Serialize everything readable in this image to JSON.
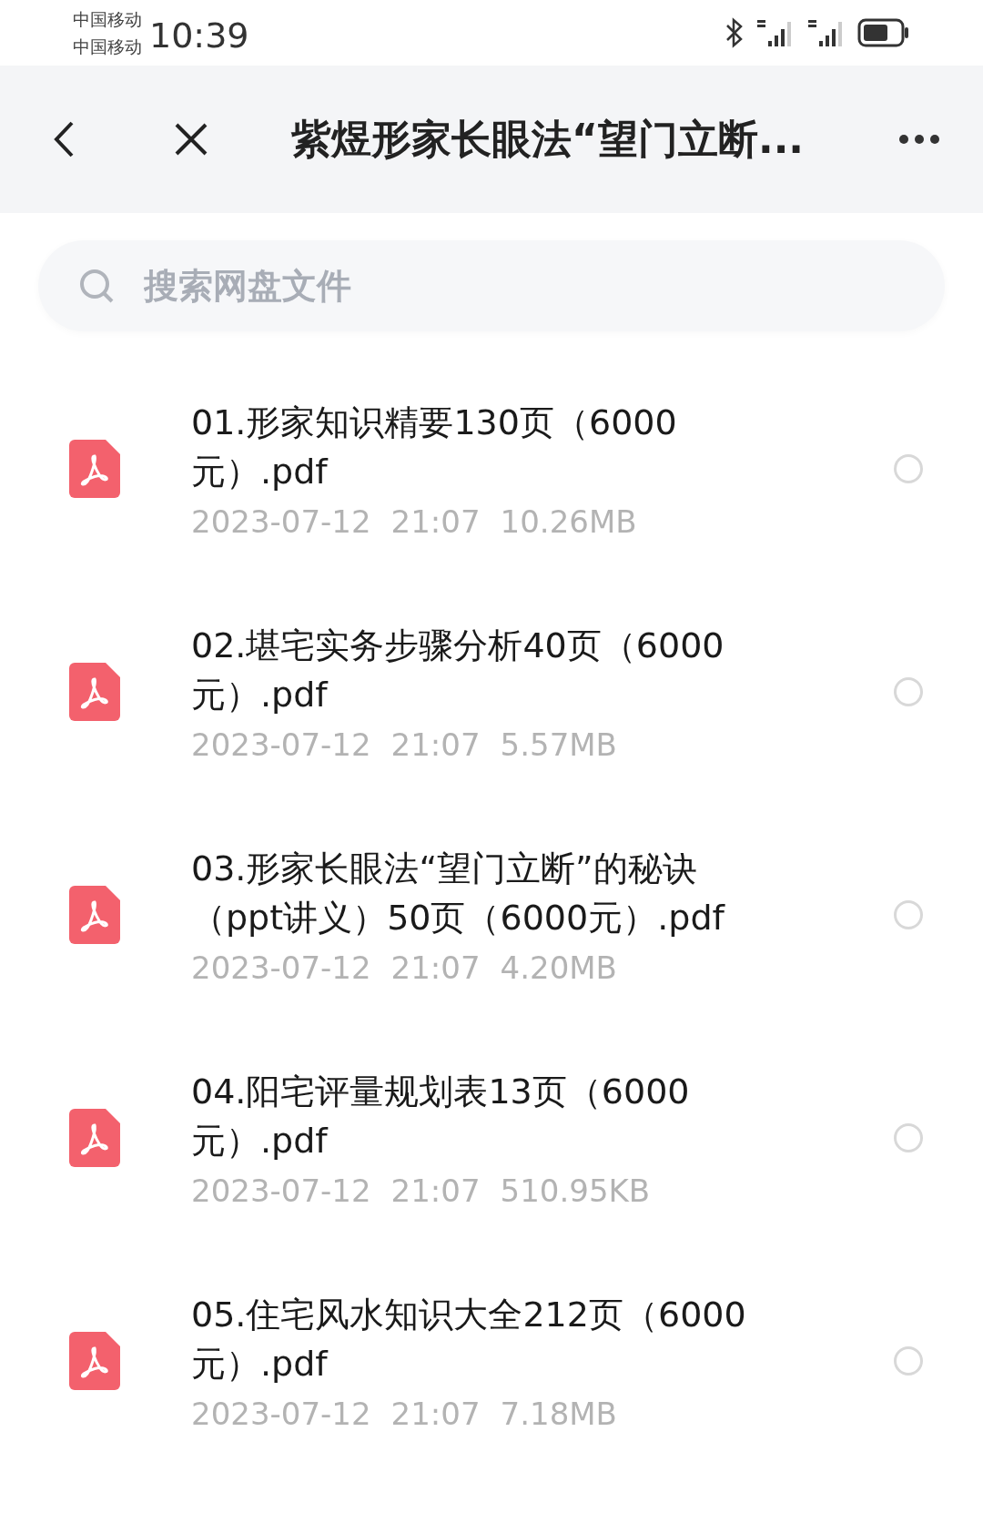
{
  "status_bar": {
    "carriers": [
      "中国移动",
      "中国移动"
    ],
    "time": "10:39"
  },
  "header": {
    "title": "紫煜形家长眼法“望门立断..."
  },
  "search": {
    "placeholder": "搜索网盘文件"
  },
  "files": [
    {
      "name": "01.形家知识精要130页（6000元）.pdf",
      "date": "2023-07-12",
      "time": "21:07",
      "size": "10.26MB",
      "selected": false
    },
    {
      "name": "02.堪宅实务步骤分析40页（6000元）.pdf",
      "date": "2023-07-12",
      "time": "21:07",
      "size": "5.57MB",
      "selected": false
    },
    {
      "name": "03.形家长眼法“望门立断”的秘诀（ppt讲义）50页（6000元）.pdf",
      "date": "2023-07-12",
      "time": "21:07",
      "size": "4.20MB",
      "selected": false
    },
    {
      "name": "04.阳宅评量规划表13页（6000元）.pdf",
      "date": "2023-07-12",
      "time": "21:07",
      "size": "510.95KB",
      "selected": false
    },
    {
      "name": "05.住宅风水知识大全212页（6000元）.pdf",
      "date": "2023-07-12",
      "time": "21:07",
      "size": "7.18MB",
      "selected": false
    }
  ]
}
